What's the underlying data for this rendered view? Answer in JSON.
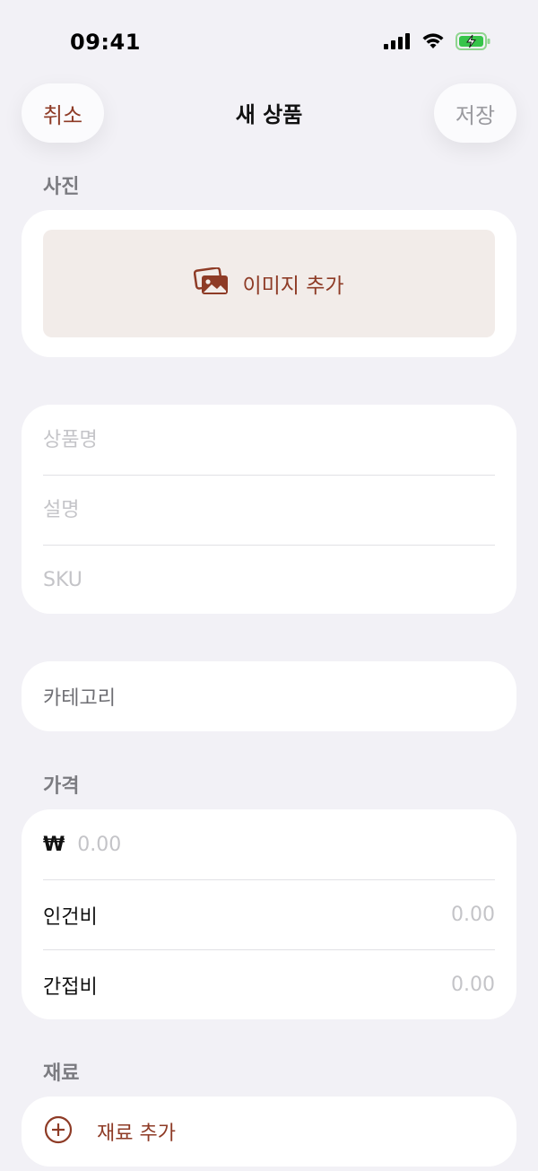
{
  "status_bar": {
    "time": "09:41",
    "icons": [
      "cellular-signal-icon",
      "wifi-icon",
      "battery-charging-icon"
    ]
  },
  "nav": {
    "cancel_label": "취소",
    "title": "새 상품",
    "save_label": "저장"
  },
  "photo_section": {
    "label": "사진",
    "add_image_label": "이미지 추가",
    "icon": "photo-stack-icon"
  },
  "info_section": {
    "name_placeholder": "상품명",
    "description_placeholder": "설명",
    "sku_placeholder": "SKU"
  },
  "category_section": {
    "label": "카테고리"
  },
  "price_section": {
    "label": "가격",
    "currency_symbol": "₩",
    "price_placeholder": "0.00",
    "labor_label": "인건비",
    "labor_value": "0.00",
    "overhead_label": "간접비",
    "overhead_value": "0.00"
  },
  "materials_section": {
    "label": "재료",
    "add_label": "재료 추가",
    "icon": "plus-circle-icon"
  },
  "colors": {
    "accent": "#8e3b26",
    "background": "#f2f1f6",
    "placeholder": "#c4c4c8"
  }
}
